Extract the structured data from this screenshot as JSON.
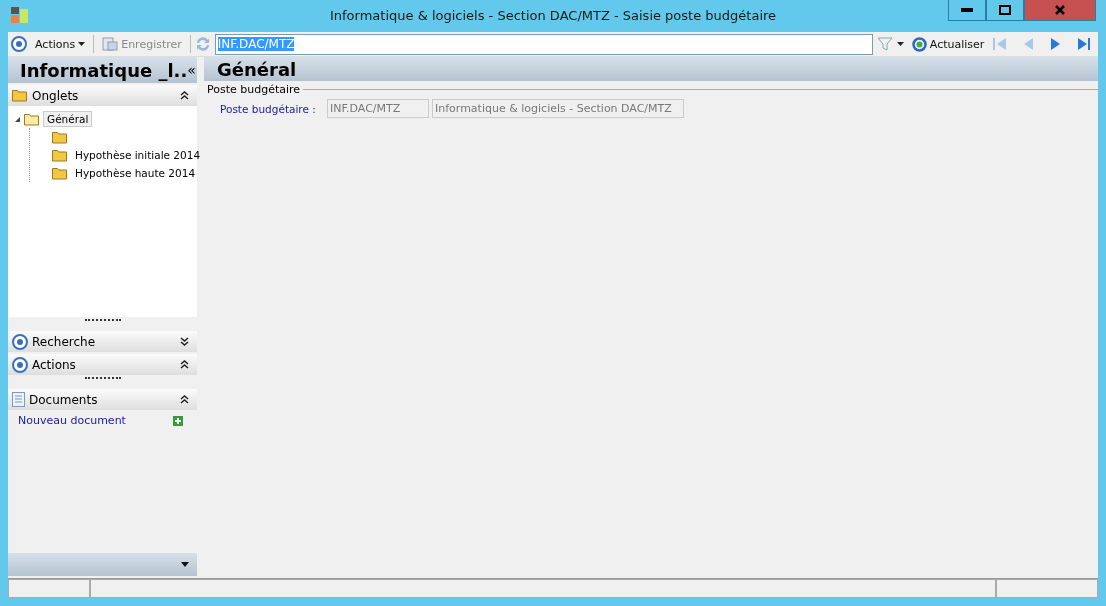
{
  "window": {
    "title": "Informatique & logiciels - Section DAC/MTZ -  Saisie poste budgétaire"
  },
  "toolbar": {
    "actions_label": "Actions",
    "save_label": "Enregistrer",
    "search_value": "INF.DAC/MTZ",
    "refresh_label": "Actualiser"
  },
  "sidebar": {
    "title": "Informatique _l..",
    "collapse_glyph": "«",
    "sections": [
      {
        "kind": "tree",
        "title": "Onglets",
        "expanded": true,
        "tree": [
          {
            "label": "Général",
            "expanded": true,
            "selected": true,
            "children": [
              {
                "kind": "folder"
              },
              {
                "kind": "folder",
                "label": "Hypothèse initiale 2014"
              },
              {
                "kind": "folder",
                "label": "Hypothèse haute 2014"
              }
            ]
          }
        ]
      },
      {
        "kind": "target",
        "title": "Recherche",
        "expanded": false
      },
      {
        "kind": "target",
        "title": "Actions",
        "expanded": true
      },
      {
        "kind": "document",
        "title": "Documents",
        "expanded": true,
        "links": [
          "Nouveau document"
        ]
      }
    ]
  },
  "main": {
    "title": "Général",
    "group": {
      "legend": "Poste budgétaire",
      "label": "Poste budgétaire :",
      "code": "INF.DAC/MTZ",
      "name": "Informatique & logiciels - Section DAC/MTZ"
    }
  }
}
